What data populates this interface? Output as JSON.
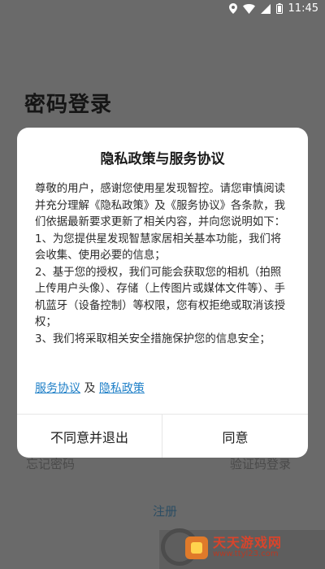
{
  "status_bar": {
    "time": "11:45"
  },
  "login_page": {
    "title": "密码登录",
    "forgot_password": "忘记密码",
    "code_login": "验证码登录",
    "register": "注册"
  },
  "dialog": {
    "title": "隐私政策与服务协议",
    "paragraphs": [
      "尊敬的用户，感谢您使用星发现智控。请您审慎阅读并充分理解《隐私政策》及《服务协议》各条款，我们依据最新要求更新了相关内容，并向您说明如下：",
      "1、为您提供星发现智慧家居相关基本功能，我们将会收集、使用必要的信息；",
      "2、基于您的授权，我们可能会获取您的相机（拍照上传用户头像）、存储（上传图片或媒体文件等）、手机蓝牙（设备控制）等权限，您有权拒绝或取消该授权；",
      "3、我们将采取相关安全措施保护您的信息安全；"
    ],
    "link_service": "服务协议",
    "link_joiner": "及",
    "link_privacy": "隐私政策",
    "decline_label": "不同意并退出",
    "agree_label": "同意"
  },
  "watermark": {
    "name": "天天游戏网",
    "url": "www.ttyl23.com"
  },
  "colors": {
    "link": "#1e7fc7",
    "overlay_bg": "#6a6a6a",
    "dialog_bg": "#ffffff"
  }
}
